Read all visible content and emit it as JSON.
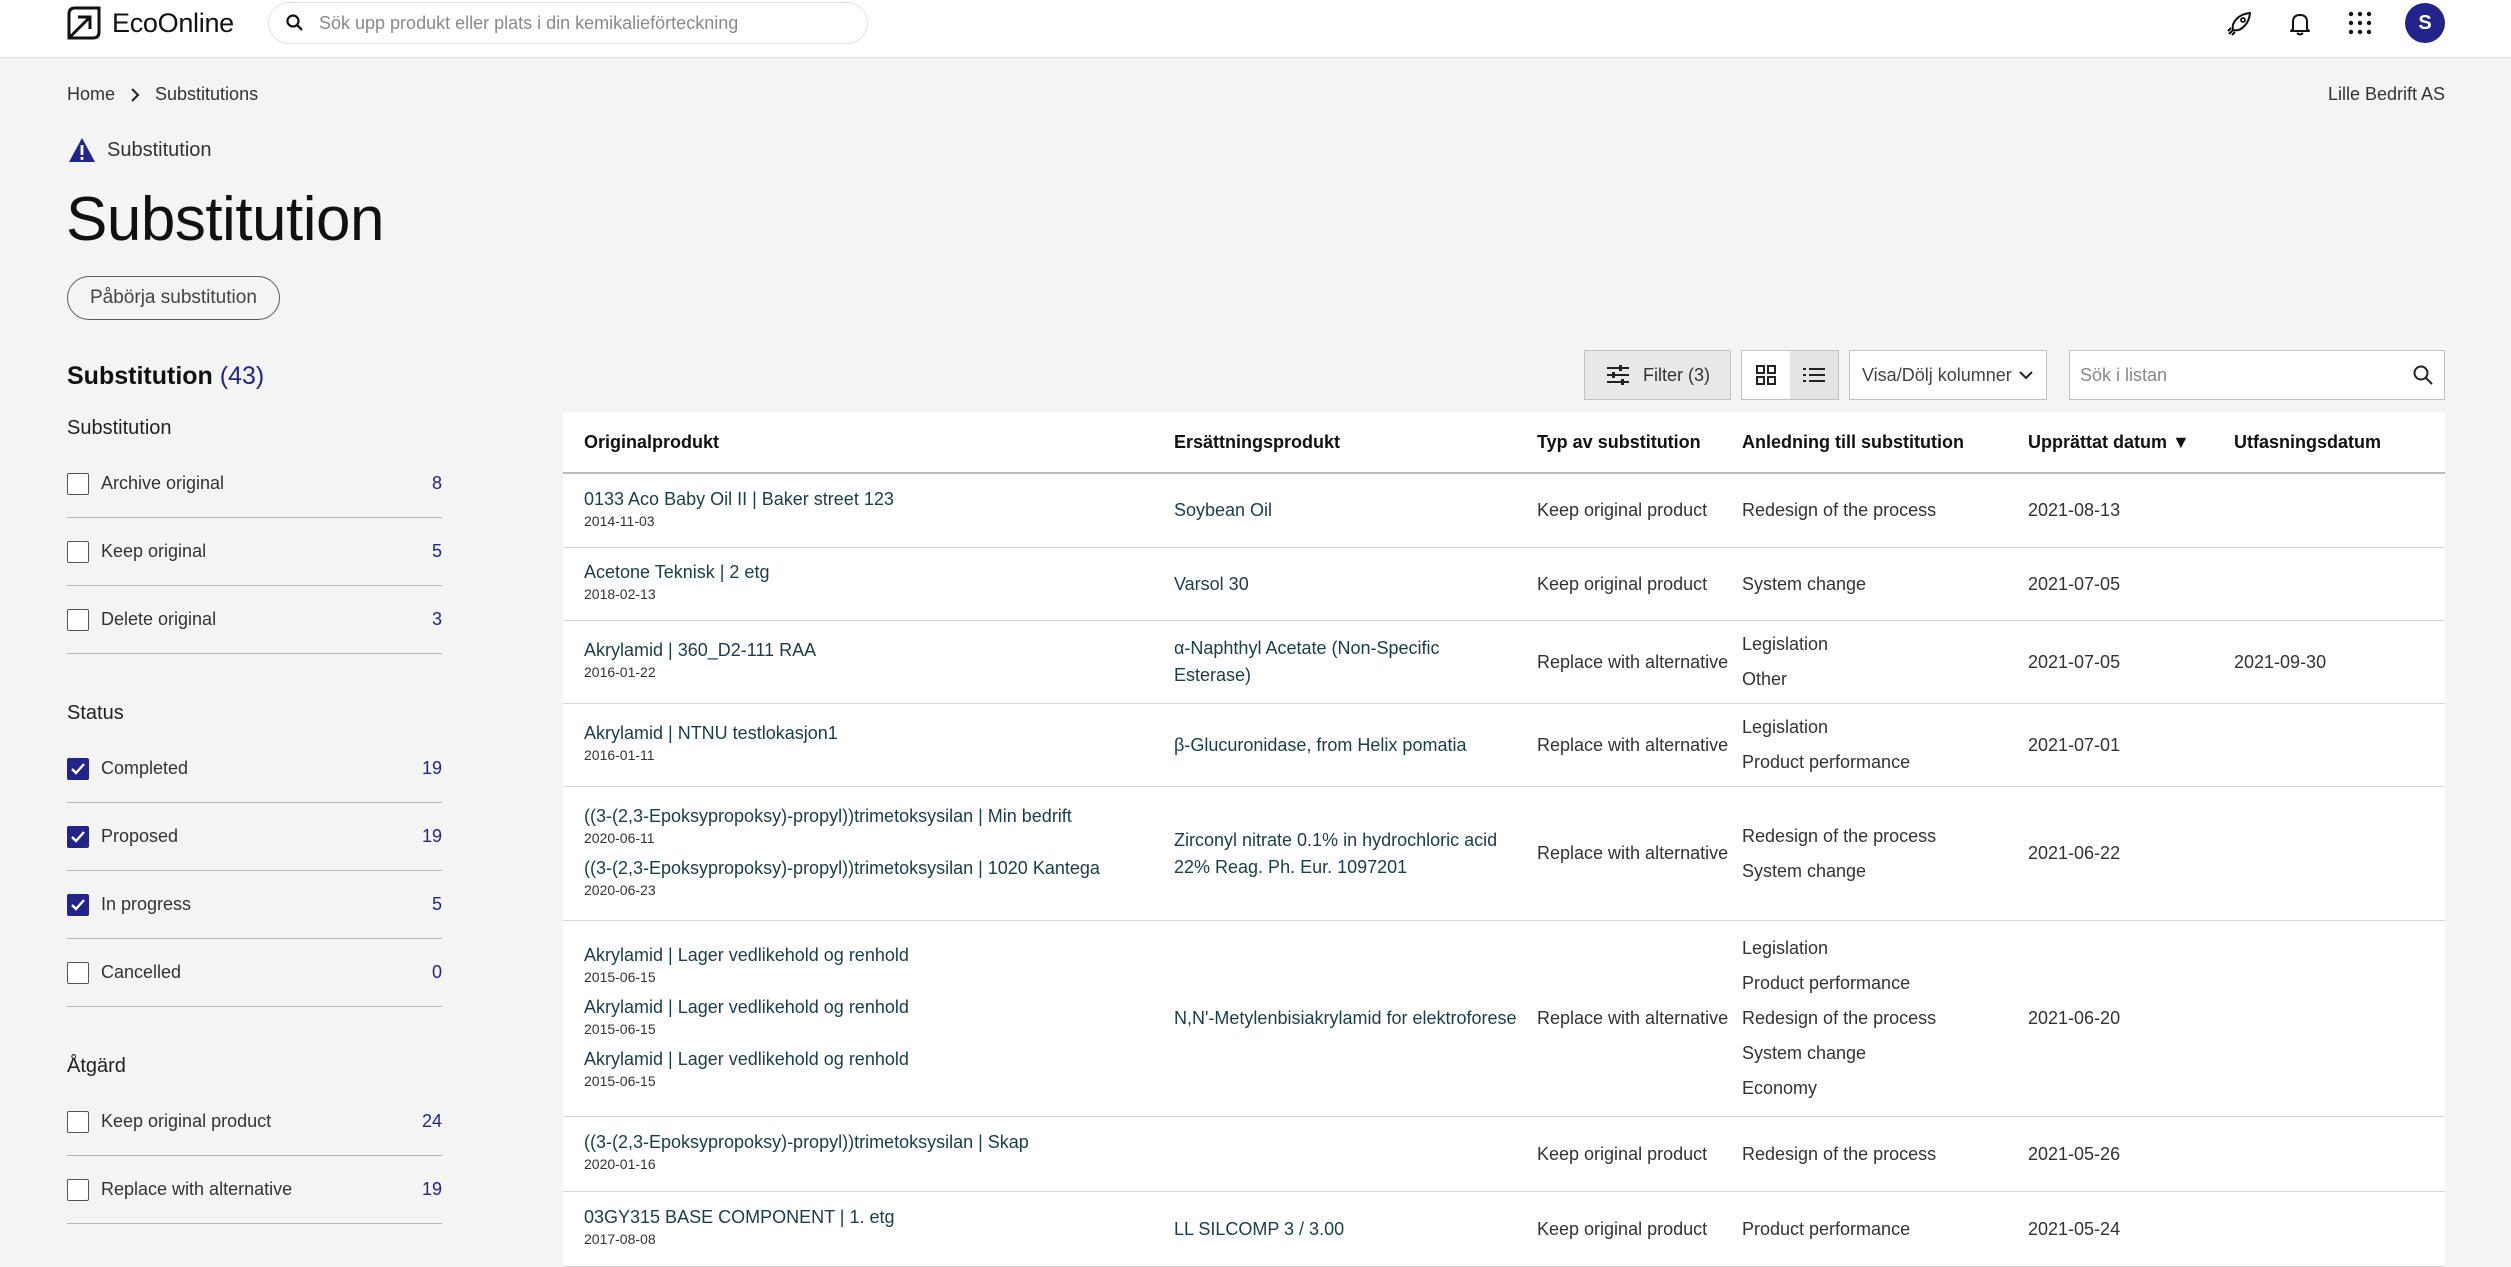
{
  "header": {
    "brand": "EcoOnline",
    "search_placeholder": "Sök upp produkt eller plats i din kemikalieförteckning",
    "avatar_initial": "S",
    "icons": [
      "rocket-icon",
      "bell-icon",
      "apps-grid-icon"
    ]
  },
  "breadcrumb": {
    "home": "Home",
    "current": "Substitutions"
  },
  "company": "Lille Bedrift AS",
  "kicker": "Substitution",
  "title": "Substitution",
  "start_button": "Påbörja substitution",
  "sidebar": {
    "title": "Substitution",
    "count": "(43)",
    "groups": [
      {
        "title": "Substitution",
        "items": [
          {
            "label": "Archive original",
            "count": "8",
            "checked": false
          },
          {
            "label": "Keep original",
            "count": "5",
            "checked": false
          },
          {
            "label": "Delete original",
            "count": "3",
            "checked": false
          }
        ]
      },
      {
        "title": "Status",
        "items": [
          {
            "label": "Completed",
            "count": "19",
            "checked": true
          },
          {
            "label": "Proposed",
            "count": "19",
            "checked": true
          },
          {
            "label": "In progress",
            "count": "5",
            "checked": true
          },
          {
            "label": "Cancelled",
            "count": "0",
            "checked": false
          }
        ]
      },
      {
        "title": "Åtgärd",
        "items": [
          {
            "label": "Keep original product",
            "count": "24",
            "checked": false
          },
          {
            "label": "Replace with alternative",
            "count": "19",
            "checked": false
          }
        ]
      }
    ]
  },
  "toolbar": {
    "filter_label": "Filter (3)",
    "columns_label": "Visa/Dölj kolumner",
    "search_placeholder": "Sök i listan"
  },
  "table": {
    "headers": {
      "original": "Originalprodukt",
      "replacement": "Ersättningsprodukt",
      "type": "Typ av substitution",
      "reason": "Anledning till substitution",
      "created": "Upprättat datum ▼",
      "phaseout": "Utfasningsdatum"
    },
    "rows": [
      {
        "originals": [
          {
            "name": "0133 Aco Baby Oil II | Baker street 123",
            "date": "2014-11-03"
          }
        ],
        "replacement": "Soybean Oil",
        "type": "Keep original product",
        "reasons": [
          "Redesign of the process"
        ],
        "created": "2021-08-13",
        "phaseout": ""
      },
      {
        "originals": [
          {
            "name": "Acetone Teknisk | 2 etg",
            "date": "2018-02-13"
          }
        ],
        "replacement": "Varsol 30",
        "type": "Keep original product",
        "reasons": [
          "System change"
        ],
        "created": "2021-07-05",
        "phaseout": ""
      },
      {
        "originals": [
          {
            "name": "Akrylamid | 360_D2-111 RAA",
            "date": "2016-01-22"
          }
        ],
        "replacement": "α-Naphthyl Acetate (Non-Specific Esterase)",
        "type": "Replace with alternative",
        "reasons": [
          "Legislation",
          "Other"
        ],
        "created": "2021-07-05",
        "phaseout": "2021-09-30"
      },
      {
        "originals": [
          {
            "name": "Akrylamid | NTNU testlokasjon1",
            "date": "2016-01-11"
          }
        ],
        "replacement": "β-Glucuronidase, from Helix pomatia",
        "type": "Replace with alternative",
        "reasons": [
          "Legislation",
          "Product performance"
        ],
        "created": "2021-07-01",
        "phaseout": ""
      },
      {
        "originals": [
          {
            "name": "((3-(2,3-Epoksypropoksy)-propyl))trimetoksysilan | Min bedrift",
            "date": "2020-06-11"
          },
          {
            "name": "((3-(2,3-Epoksypropoksy)-propyl))trimetoksysilan | 1020 Kantega",
            "date": "2020-06-23"
          }
        ],
        "replacement": "Zirconyl nitrate 0.1% in hydrochloric acid 22% Reag. Ph. Eur. 1097201",
        "type": "Replace with alternative",
        "reasons": [
          "Redesign of the process",
          "System change"
        ],
        "created": "2021-06-22",
        "phaseout": ""
      },
      {
        "originals": [
          {
            "name": "Akrylamid | Lager vedlikehold og renhold",
            "date": "2015-06-15"
          },
          {
            "name": "Akrylamid | Lager vedlikehold og renhold",
            "date": "2015-06-15"
          },
          {
            "name": "Akrylamid | Lager vedlikehold og renhold",
            "date": "2015-06-15"
          }
        ],
        "replacement": "N,N'-Metylenbisiakrylamid for elektroforese",
        "type": "Replace with alternative",
        "reasons": [
          "Legislation",
          "Product performance",
          "Redesign of the process",
          "System change",
          "Economy"
        ],
        "created": "2021-06-20",
        "phaseout": ""
      },
      {
        "originals": [
          {
            "name": "((3-(2,3-Epoksypropoksy)-propyl))trimetoksysilan | Skap",
            "date": "2020-01-16"
          }
        ],
        "replacement": "",
        "type": "Keep original product",
        "reasons": [
          "Redesign of the process"
        ],
        "created": "2021-05-26",
        "phaseout": ""
      },
      {
        "originals": [
          {
            "name": "03GY315 BASE COMPONENT | 1. etg",
            "date": "2017-08-08"
          }
        ],
        "replacement": "LL SILCOMP 3 / 3.00",
        "type": "Keep original product",
        "reasons": [
          "Product performance"
        ],
        "created": "2021-05-24",
        "phaseout": ""
      }
    ]
  }
}
